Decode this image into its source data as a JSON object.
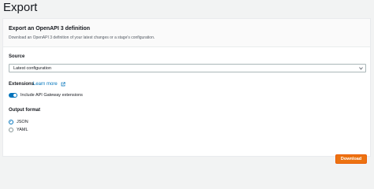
{
  "page": {
    "title": "Export"
  },
  "panel": {
    "title": "Export an OpenAPI 3 definition",
    "description": "Download an OpenAPI 3 definition of your latest changes or a stage's configuration."
  },
  "source": {
    "label": "Source",
    "selected": "Latest configuration"
  },
  "extensions": {
    "label": "Extensions",
    "learn_more": "Learn more",
    "toggle_label": "Include API Gateway extensions",
    "toggle_on": true
  },
  "output_format": {
    "label": "Output format",
    "options": [
      {
        "label": "JSON",
        "selected": true
      },
      {
        "label": "YAML",
        "selected": false
      }
    ]
  },
  "actions": {
    "download_label": "Download"
  },
  "colors": {
    "accent": "#0073bb",
    "primary_button": "#ec7211"
  }
}
